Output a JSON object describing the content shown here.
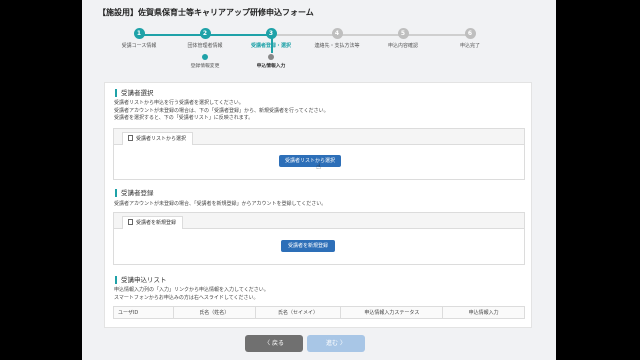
{
  "page": {
    "title": "【施設用】佐賀県保育士等キャリアアップ研修申込フォーム"
  },
  "stepper": {
    "steps": [
      {
        "num": "1",
        "label": "受講コース情報",
        "state": "done"
      },
      {
        "num": "2",
        "label": "団体管理者情報",
        "state": "done"
      },
      {
        "num": "3",
        "label": "受講者登録・選択",
        "state": "active"
      },
      {
        "num": "4",
        "label": "連絡先・支払方法等",
        "state": "todo"
      },
      {
        "num": "5",
        "label": "申込内容確認",
        "state": "todo"
      },
      {
        "num": "6",
        "label": "申込完了",
        "state": "todo"
      }
    ],
    "substeps": [
      {
        "label": "登録情報変更"
      },
      {
        "label": "申込情報入力"
      }
    ]
  },
  "select_section": {
    "title": "受講者選択",
    "desc1": "受講者リストから申込を行う受講者を選択してください。",
    "desc2": "受講者アカウントが未登録の場合は、下の「受講者登録」から、新規受講者を行ってください。",
    "desc3": "受講者を選択すると、下の「受講者リスト」に反映されます。",
    "tab_label": "受講者リストから選択",
    "button_label": "受講者リストから選択"
  },
  "register_section": {
    "title": "受講者登録",
    "desc": "受講者アカウントが未登録の場合、「受講者を新規登録」からアカウントを登録してください。",
    "tab_label": "受講者を新規登録",
    "button_label": "受講者を新規登録"
  },
  "list_section": {
    "title": "受講申込リスト",
    "desc1": "申込情報入力列の「入力」リンクから申込情報を入力してください。",
    "desc2": "スマートフォンからお申込みの方は右へスライドしてください。",
    "columns": [
      "ユーザID",
      "氏名（姓名）",
      "氏名（セイメイ）",
      "申込情報入力ステータス",
      "申込情報入力"
    ]
  },
  "footer": {
    "back_label": "〈 戻る",
    "next_label": "進む 〉"
  }
}
